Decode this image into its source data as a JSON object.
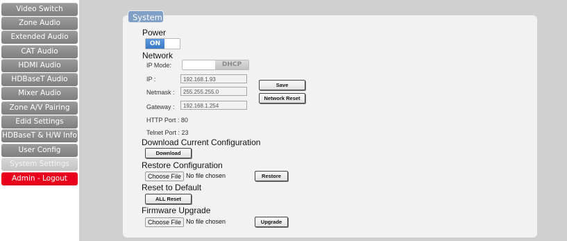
{
  "sidebar": {
    "items": [
      {
        "label": "Video Switch"
      },
      {
        "label": "Zone Audio"
      },
      {
        "label": "Extended Audio"
      },
      {
        "label": "CAT Audio"
      },
      {
        "label": "HDMI Audio"
      },
      {
        "label": "HDBaseT Audio"
      },
      {
        "label": "Mixer Audio"
      },
      {
        "label": "Zone A/V Pairing"
      },
      {
        "label": "Edid Settings"
      },
      {
        "label": "HDBaseT & H/W Info"
      },
      {
        "label": "User Config"
      },
      {
        "label": "System Settings"
      },
      {
        "label": "Admin - Logout"
      }
    ],
    "active_item": "System Settings",
    "logout_color": "#e8001c"
  },
  "panel": {
    "title": "System"
  },
  "power": {
    "heading": "Power",
    "toggle_label": "ON",
    "state": "on"
  },
  "network": {
    "heading": "Network",
    "ip_mode_label": "IP Mode:",
    "ip_mode_value": "DHCP",
    "ip_label": "IP :",
    "ip_value": "192.168.1.93",
    "netmask_label": "Netmask :",
    "netmask_value": "255.255.255.0",
    "gateway_label": "Gateway :",
    "gateway_value": "192.168.1.254",
    "http_port": "HTTP Port : 80",
    "telnet_port": "Telnet Port : 23",
    "save_label": "Save",
    "reset_label": "Network Reset"
  },
  "download": {
    "heading": "Download Current Configuration",
    "button_label": "Download"
  },
  "restore": {
    "heading": "Restore Configuration",
    "choose_label": "Choose File",
    "file_status": "No file chosen",
    "button_label": "Restore"
  },
  "reset": {
    "heading": "Reset to Default",
    "button_label": "ALL Reset"
  },
  "firmware": {
    "heading": "Firmware Upgrade",
    "choose_label": "Choose File",
    "file_status": "No file chosen",
    "button_label": "Upgrade"
  },
  "colors": {
    "accent_blue": "#3a78c6",
    "title_tab": "#7f9fc6"
  }
}
